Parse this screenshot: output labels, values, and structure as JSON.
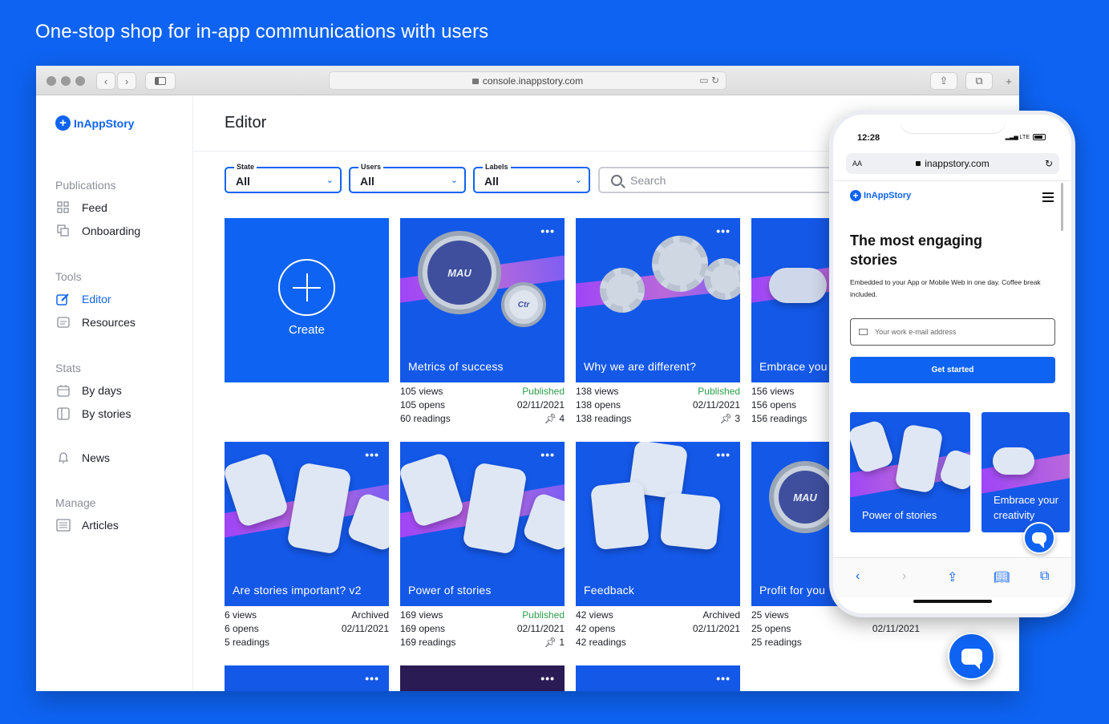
{
  "headline": "One-stop shop for in-app communications with users",
  "browser": {
    "url": "console.inappstory.com",
    "nav_back": "‹",
    "nav_forward": "›"
  },
  "brand": "InAppStory",
  "sidebar": {
    "sections": [
      {
        "title": "Publications",
        "items": [
          {
            "label": "Feed",
            "icon": "grid-icon"
          },
          {
            "label": "Onboarding",
            "icon": "copy-icon"
          }
        ]
      },
      {
        "title": "Tools",
        "items": [
          {
            "label": "Editor",
            "icon": "edit-icon",
            "active": true
          },
          {
            "label": "Resources",
            "icon": "document-icon"
          }
        ]
      },
      {
        "title": "Stats",
        "items": [
          {
            "label": "By days",
            "icon": "calendar-icon"
          },
          {
            "label": "By stories",
            "icon": "panel-icon"
          }
        ]
      },
      {
        "title": "",
        "items": [
          {
            "label": "News",
            "icon": "bell-icon"
          }
        ]
      },
      {
        "title": "Manage",
        "items": [
          {
            "label": "Articles",
            "icon": "list-icon"
          }
        ]
      }
    ]
  },
  "main": {
    "title": "Editor",
    "filters": [
      {
        "label": "State",
        "value": "All"
      },
      {
        "label": "Users",
        "value": "All"
      },
      {
        "label": "Labels",
        "value": "All"
      }
    ],
    "search_placeholder": "Search",
    "create_label": "Create",
    "menu_glyph": "•••",
    "cards": [
      {
        "title": "Metrics of success",
        "views": "105 views",
        "opens": "105 opens",
        "readings": "60 readings",
        "status": "Published",
        "date": "02/11/2021",
        "pins": "4"
      },
      {
        "title": "Why we are different?",
        "views": "138 views",
        "opens": "138 opens",
        "readings": "138 readings",
        "status": "Published",
        "date": "02/11/2021",
        "pins": "3"
      },
      {
        "title": "Embrace you",
        "views": "156 views",
        "opens": "156 opens",
        "readings": "156 readings",
        "status": "",
        "date": "",
        "pins": ""
      },
      {
        "title": "Are stories important? v2",
        "views": "6 views",
        "opens": "6 opens",
        "readings": "5 readings",
        "status": "Archived",
        "date": "02/11/2021",
        "pins": ""
      },
      {
        "title": "Power of stories",
        "views": "169 views",
        "opens": "169 opens",
        "readings": "169 readings",
        "status": "Published",
        "date": "02/11/2021",
        "pins": "1"
      },
      {
        "title": "Feedback",
        "views": "42 views",
        "opens": "42 opens",
        "readings": "42 readings",
        "status": "Archived",
        "date": "02/11/2021",
        "pins": ""
      },
      {
        "title": "Profit for you",
        "views": "25 views",
        "opens": "25 opens",
        "readings": "25 readings",
        "status": "",
        "date": "02/11/2021",
        "pins": ""
      }
    ],
    "gauge_label": "MAU",
    "gauge_small_label": "Ctr"
  },
  "phone": {
    "time": "12:28",
    "network": "LTE",
    "aa": "AA",
    "url": "inappstory.com",
    "hero": "The most engaging stories",
    "subtitle": "Embedded to your App or Mobile Web in one day. Coffee break included.",
    "email_placeholder": "Your work e-mail address",
    "cta": "Get started",
    "cards": [
      "Power of stories",
      "Embrace your creativity"
    ]
  },
  "colors": {
    "brand": "#0e63f2",
    "published": "#2a9d4a"
  }
}
